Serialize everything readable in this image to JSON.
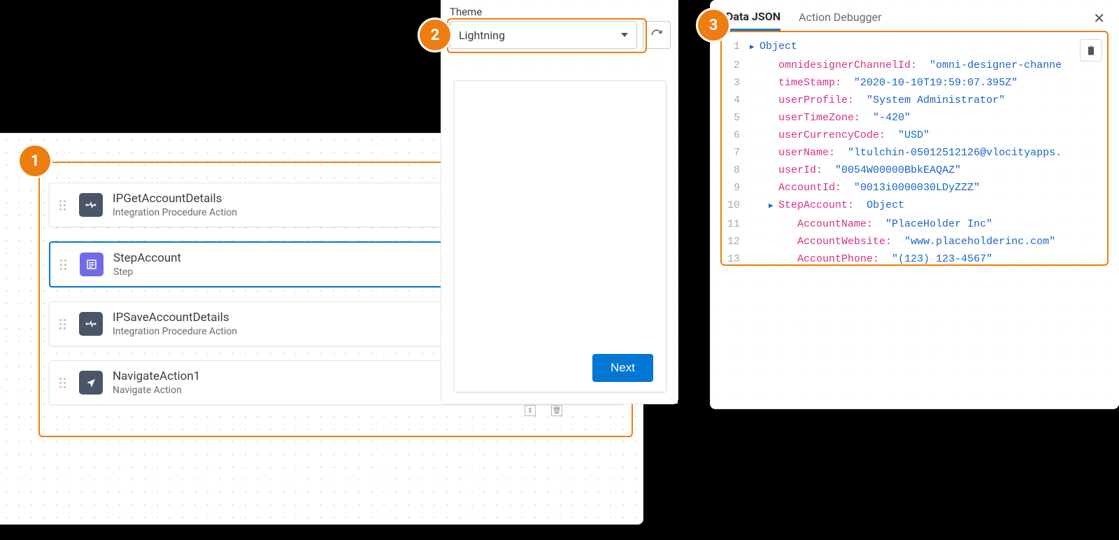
{
  "badges": {
    "b1": "1",
    "b2": "2",
    "b3": "3"
  },
  "steps": {
    "items": [
      {
        "title": "IPGetAccountDetails",
        "sub": "Integration Procedure Action",
        "iconClass": "icon-ip",
        "selected": false
      },
      {
        "title": "StepAccount",
        "sub": "Step",
        "iconClass": "icon-step",
        "selected": true
      },
      {
        "title": "IPSaveAccountDetails",
        "sub": "Integration Procedure Action",
        "iconClass": "icon-ip",
        "selected": false
      },
      {
        "title": "NavigateAction1",
        "sub": "Navigate Action",
        "iconClass": "icon-nav",
        "selected": false
      }
    ]
  },
  "theme": {
    "label": "Theme",
    "selected": "Lightning"
  },
  "preview": {
    "next": "Next"
  },
  "debugTabs": {
    "data": "Data JSON",
    "action": "Action Debugger"
  },
  "json": {
    "lines": [
      {
        "n": "1",
        "indent": 0,
        "tri": true,
        "kClass": "kb",
        "key": "Object",
        "val": ""
      },
      {
        "n": "2",
        "indent": 1,
        "tri": false,
        "kClass": "k",
        "key": "omnidesignerChannelId:",
        "val": "\"omni-designer-channe"
      },
      {
        "n": "3",
        "indent": 1,
        "tri": false,
        "kClass": "k",
        "key": "timeStamp:",
        "val": "\"2020-10-10T19:59:07.395Z\""
      },
      {
        "n": "4",
        "indent": 1,
        "tri": false,
        "kClass": "k",
        "key": "userProfile:",
        "val": "\"System Administrator\""
      },
      {
        "n": "5",
        "indent": 1,
        "tri": false,
        "kClass": "k",
        "key": "userTimeZone:",
        "val": "\"-420\""
      },
      {
        "n": "6",
        "indent": 1,
        "tri": false,
        "kClass": "k",
        "key": "userCurrencyCode:",
        "val": "\"USD\""
      },
      {
        "n": "7",
        "indent": 1,
        "tri": false,
        "kClass": "k",
        "key": "userName:",
        "val": "\"ltulchin-05012512126@vlocityapps."
      },
      {
        "n": "8",
        "indent": 1,
        "tri": false,
        "kClass": "k",
        "key": "userId:",
        "val": "\"0054W00000BbkEAQAZ\""
      },
      {
        "n": "9",
        "indent": 1,
        "tri": false,
        "kClass": "k",
        "key": "AccountId:",
        "val": "\"0013i0000030LDyZZZ\""
      },
      {
        "n": "10",
        "indent": 1,
        "tri": true,
        "kClass": "k",
        "key": "StepAccount:",
        "val": "Object",
        "valClass": "kb"
      },
      {
        "n": "11",
        "indent": 2,
        "tri": false,
        "kClass": "k",
        "key": "AccountName:",
        "val": "\"PlaceHolder Inc\""
      },
      {
        "n": "12",
        "indent": 2,
        "tri": false,
        "kClass": "k",
        "key": "AccountWebsite:",
        "val": "\"www.placeholderinc.com\""
      },
      {
        "n": "13",
        "indent": 2,
        "tri": false,
        "kClass": "k",
        "key": "AccountPhone:",
        "val": "\"(123) 123-4567\""
      }
    ]
  }
}
